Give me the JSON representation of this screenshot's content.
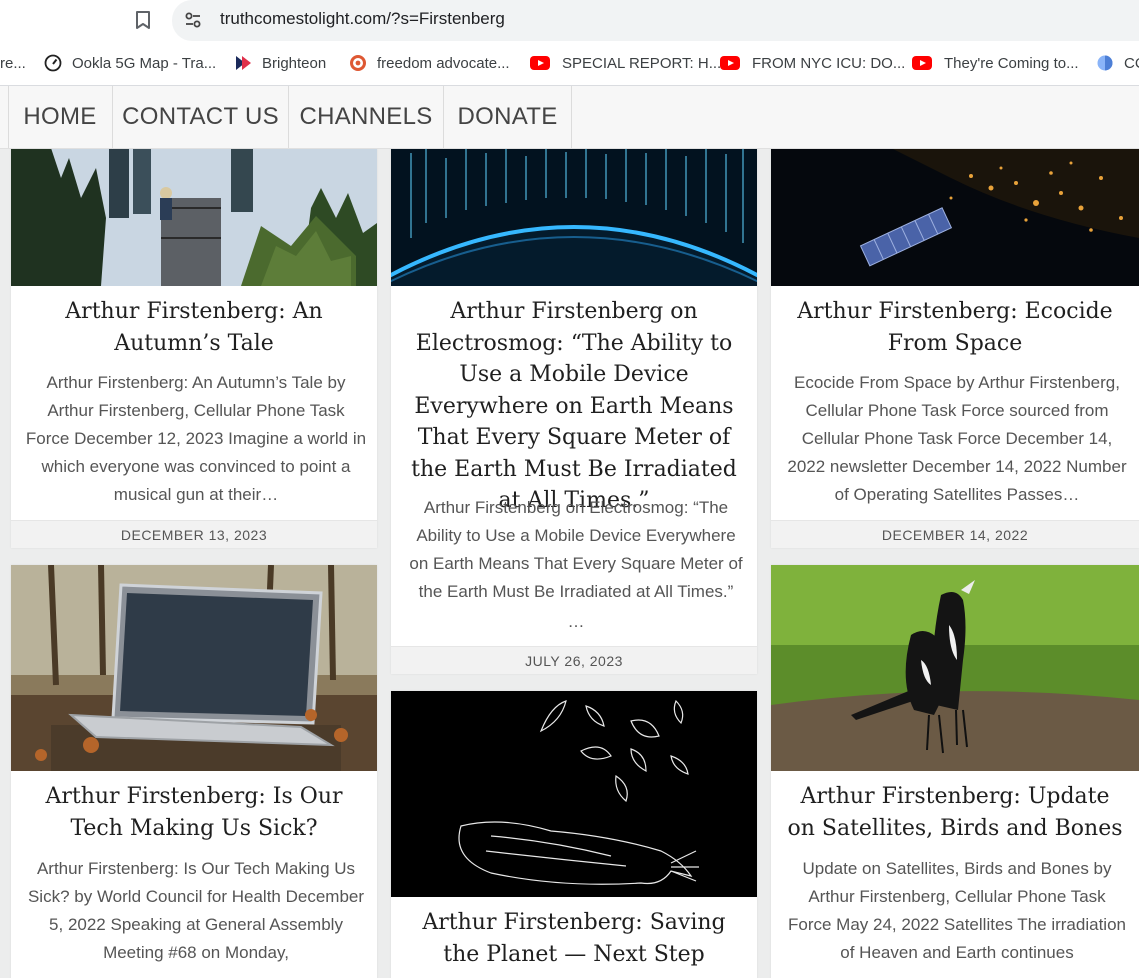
{
  "browser": {
    "url": "truthcomestolight.com/?s=Firstenberg",
    "bookmarks": [
      {
        "label": "re...",
        "icon": "none"
      },
      {
        "label": "Ookla 5G Map - Tra...",
        "icon": "speedometer-icon"
      },
      {
        "label": "Brighteon",
        "icon": "brighteon-icon"
      },
      {
        "label": "freedom advocate...",
        "icon": "duckduckgo-icon"
      },
      {
        "label": "SPECIAL REPORT: H...",
        "icon": "youtube-icon"
      },
      {
        "label": "FROM NYC ICU: DO...",
        "icon": "youtube-icon"
      },
      {
        "label": "They're Coming to...",
        "icon": "youtube-icon"
      },
      {
        "label": "CC",
        "icon": "globe-icon"
      }
    ]
  },
  "nav": {
    "items": [
      "HOME",
      "CONTACT US",
      "CHANNELS",
      "DONATE"
    ]
  },
  "posts": [
    {
      "title": "Arthur Firstenberg: An Autumn’s Tale",
      "excerpt": "Arthur Firstenberg: An Autumn’s Tale by Arthur Firstenberg, Cellular Phone Task Force December 12, 2023   Imagine a world in which everyone was convinced to point a musical gun at their…",
      "date": "DECEMBER 13, 2023",
      "image": "cell-tower-photo"
    },
    {
      "title": "Arthur Firstenberg on Electrosmog: “The Ability to Use a Mobile Device Everywhere on Earth Means That Every Square Meter of the Earth Must Be Irradiated at All Times.”",
      "excerpt": "Arthur Firstenberg on Electrosmog: “The Ability to Use a Mobile Device Everywhere on Earth Means That Every Square Meter of the Earth Must Be Irradiated at All Times.”",
      "excerpt_more": "…",
      "date": "JULY 26, 2023",
      "image": "earth-signal-photo"
    },
    {
      "title": "Arthur Firstenberg: Ecocide From Space",
      "excerpt": "Ecocide From Space by Arthur Firstenberg, Cellular Phone Task Force sourced from Cellular Phone Task Force December 14, 2022 newsletter December 14, 2022 Number of Operating Satellites Passes…",
      "date": "DECEMBER 14, 2022",
      "image": "satellite-night-earth-photo"
    },
    {
      "title": "Arthur Firstenberg: Is Our Tech Making Us Sick?",
      "excerpt": "Arthur Firstenberg: Is Our Tech Making Us Sick? by World Council for Health December 5, 2022    Speaking at General Assembly Meeting #68 on Monday,",
      "image": "laptop-in-forest-photo"
    },
    {
      "title": "Arthur Firstenberg: Saving the Planet — Next Step",
      "image": "dead-bird-leaves-drawing"
    },
    {
      "title": "Arthur Firstenberg: Update on Satellites, Birds and Bones",
      "excerpt": "Update on Satellites, Birds and Bones by Arthur Firstenberg, Cellular Phone Task Force May 24, 2022   Satellites The irradiation of Heaven and Earth continues",
      "image": "magpies-on-grass-photo"
    }
  ]
}
